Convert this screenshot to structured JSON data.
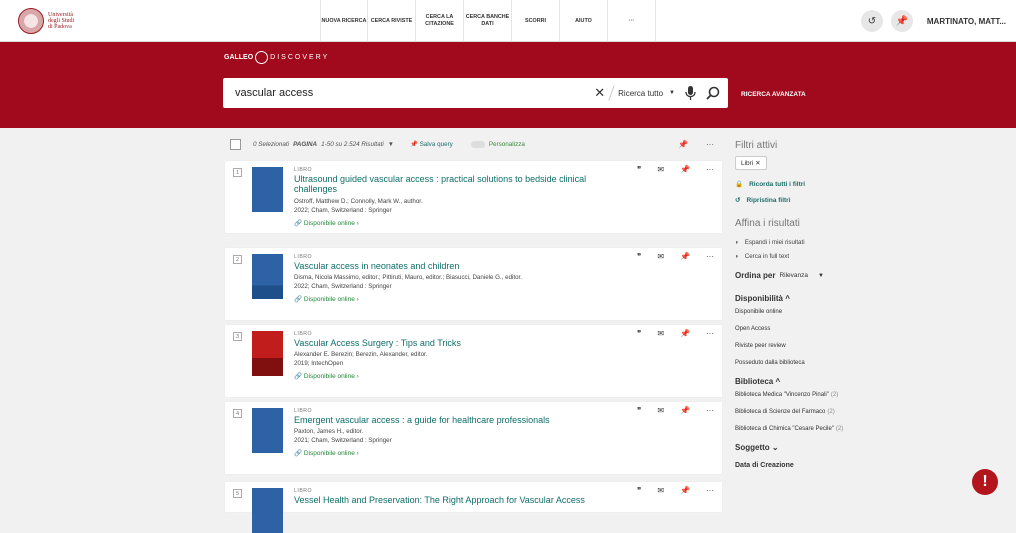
{
  "logo": {
    "line1": "Università",
    "line2": "degli Studi",
    "line3": "di Padova"
  },
  "nav": [
    {
      "label": "NUOVA RICERCA"
    },
    {
      "label": "CERCA RIVISTE"
    },
    {
      "label": "CERCA LA CITAZIONE"
    },
    {
      "label": "CERCA BANCHE DATI"
    },
    {
      "label": "SCORRI"
    },
    {
      "label": "AIUTO"
    },
    {
      "label": "···"
    }
  ],
  "user": {
    "name": "MARTINATO, MATT..."
  },
  "brand": {
    "a": "GAL",
    "b": "LEO",
    "c": "DISCOVERY"
  },
  "search": {
    "value": "vascular access",
    "scope": "Ricerca tutto",
    "advanced": "RICERCA AVANZATA"
  },
  "toolbar": {
    "selected": "0 Selezionati",
    "pagina": "PAGINA",
    "range": "1-50 su 2.524 Risultati",
    "save": "Salva query",
    "personalize": "Personalizza"
  },
  "results": [
    {
      "num": "1",
      "type": "LIBRO",
      "title": "Ultrasound guided vascular access : practical solutions to bedside clinical challenges",
      "authors": "Ostroff, Matthew D.; Connolly, Mark W., author.",
      "pub": "2022; Cham, Switzerland : Springer",
      "online": "Disponibile online"
    },
    {
      "num": "2",
      "type": "LIBRO",
      "title": "Vascular access in neonates and children",
      "authors": "Disma, Nicola Massimo, editor.; Pittiruti, Mauro, editor.; Biasucci, Daniele G., editor.",
      "pub": "2022; Cham, Switzerland : Springer",
      "online": "Disponibile online"
    },
    {
      "num": "3",
      "type": "LIBRO",
      "title": "Vascular Access Surgery : Tips and Tricks",
      "authors": "Alexander E. Berezin; Berezin, Alexander, editor.",
      "pub": "2019; IntechOpen",
      "online": "Disponibile online"
    },
    {
      "num": "4",
      "type": "LIBRO",
      "title": "Emergent vascular access : a guide for healthcare professionals",
      "authors": "Paxton, James H., editor.",
      "pub": "2021; Cham, Switzerland : Springer",
      "online": "Disponibile online"
    },
    {
      "num": "5",
      "type": "LIBRO",
      "title": "Vessel Health and Preservation: The Right Approach for Vascular Access",
      "authors": "",
      "pub": "",
      "online": ""
    }
  ],
  "facets": {
    "active_title": "Filtri attivi",
    "chip": "Libri",
    "remember": "Ricorda tutti i filtri",
    "restore": "Ripristina filtri",
    "refine_title": "Affina i risultati",
    "expand": "Espandi i miei risultati",
    "fulltext": "Cerca in full text",
    "order_label": "Ordina per",
    "order_value": "Rilevanza",
    "avail_title": "Disponibilità",
    "avail": [
      "Disponibile online",
      "Open Access",
      "Riviste peer review",
      "Posseduto dalla biblioteca"
    ],
    "lib_title": "Biblioteca",
    "libs": [
      {
        "name": "Biblioteca Medica \"Vincenzo Pinali\"",
        "count": "(2)"
      },
      {
        "name": "Biblioteca di Scienze del Farmaco",
        "count": "(2)"
      },
      {
        "name": "Biblioteca di Chimica \"Cesare Pecile\"",
        "count": "(2)"
      }
    ],
    "subject_title": "Soggetto",
    "date_title": "Data di Creazione"
  },
  "colors": {
    "brand_red": "#a00a1c",
    "link_teal": "#0f6e68",
    "online_green": "#23863a"
  }
}
